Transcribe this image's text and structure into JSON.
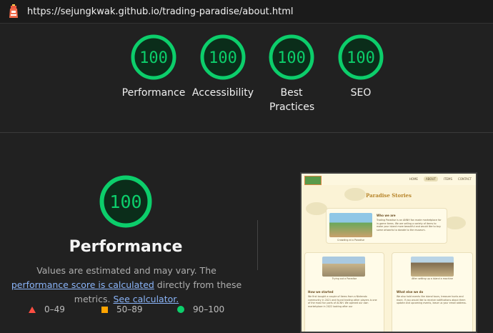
{
  "url": "https://sejungkwak.github.io/trading-paradise/about.html",
  "gauges": [
    {
      "score": "100",
      "label": "Performance"
    },
    {
      "score": "100",
      "label": "Accessibility"
    },
    {
      "score": "100",
      "label": "Best Practices"
    },
    {
      "score": "100",
      "label": "SEO"
    }
  ],
  "performance": {
    "score": "100",
    "title": "Performance",
    "desc_prefix": "Values are estimated and may vary. The ",
    "link_score": "performance score is calculated",
    "desc_middle": " directly from these metrics. ",
    "link_calc": "See calculator."
  },
  "legend": [
    {
      "shape": "triangle",
      "range": "0–49",
      "color": "#ff4e42"
    },
    {
      "shape": "square",
      "range": "50–89",
      "color": "#ffa400"
    },
    {
      "shape": "circle",
      "range": "90–100",
      "color": "#0cce6b"
    }
  ],
  "colors": {
    "pass": "#0cce6b",
    "pass_fill": "#0b2d1a",
    "background": "#212121",
    "link": "#8ab4f8"
  },
  "thumbnail": {
    "nav": [
      "HOME",
      "ABOUT",
      "ITEMS",
      "CONTACT"
    ],
    "title": "Paradise Stories",
    "who_heading": "Who we are",
    "who_text": "Trading Paradise is an ANNH fan made marketplace for in-game items. We are selling a variety of items to make your island more beautiful and would like to buy some artworks to donate to the museum.",
    "img1_caption": "Crowding at a Paradise",
    "img2_caption": "Trying out a Paradise",
    "img3_caption": "After setting up a island a machine",
    "how_heading": "How we started",
    "how_text": "We first bought a couple of items from a Nintendo community in 2021 and found trading other players is one of the most fun parts of ACNH. We opened our own marketplace in 2022 looking after our",
    "what_heading": "What else we do",
    "what_text": "We also hold events like island tours, treasure hunts and more. If you would like to receive notifications about them update and upcoming events, leave us your email address."
  }
}
